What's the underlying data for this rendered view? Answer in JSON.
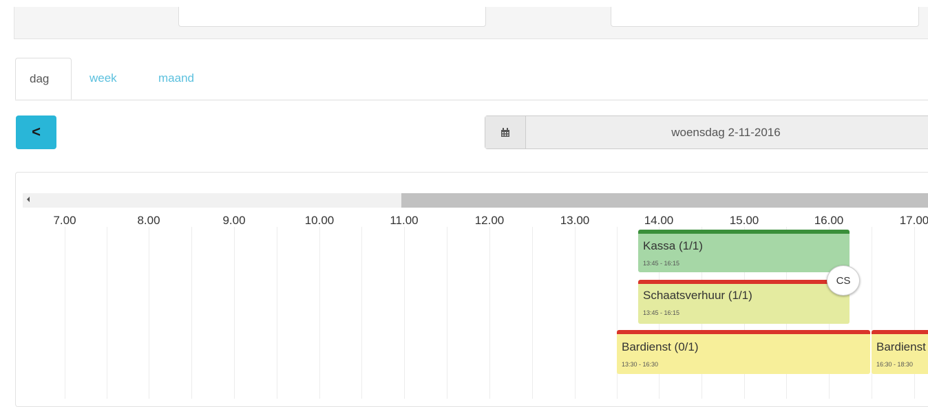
{
  "tabs": [
    {
      "label": "dag",
      "active": true
    },
    {
      "label": "week",
      "active": false
    },
    {
      "label": "maand",
      "active": false
    }
  ],
  "nav": {
    "prev_label": "<",
    "prev_icon": "chevron-left-icon"
  },
  "date_picker": {
    "icon": "calendar-icon",
    "value": "woensdag 2-11-2016"
  },
  "timeline": {
    "hours": [
      "7.00",
      "8.00",
      "9.00",
      "10.00",
      "11.00",
      "12.00",
      "13.00",
      "14.00",
      "15.00",
      "16.00",
      "17.00"
    ]
  },
  "shifts": [
    {
      "title": "Kassa (1/1)",
      "time": "13:45 - 16:15",
      "status_color": "#3a8f3a",
      "fill_color": "#a6d7a6"
    },
    {
      "title": "Schaatsverhuur (1/1)",
      "time": "13:45 - 16:15",
      "status_color": "#d9342a",
      "fill_color": "#e4eba0"
    },
    {
      "title": "Bardienst (0/1)",
      "time": "13:30 - 16:30",
      "status_color": "#d9342a",
      "fill_color": "#f7ef9a"
    },
    {
      "title": "Bardienst",
      "time": "16:30 - 18:30",
      "status_color": "#d9342a",
      "fill_color": "#f7ef9a"
    }
  ],
  "badge": {
    "initials": "CS"
  }
}
